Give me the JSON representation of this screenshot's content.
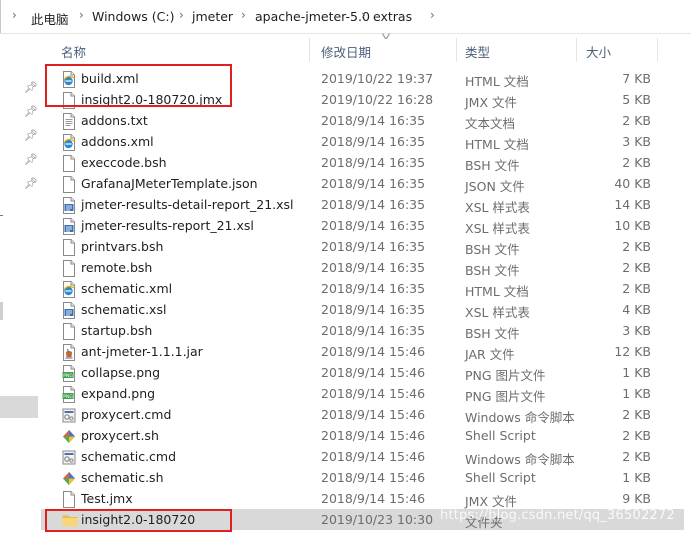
{
  "breadcrumb": [
    "此电脑",
    "Windows (C:)",
    "jmeter",
    "apache-jmeter-5.0",
    "extras"
  ],
  "columns": {
    "name": "名称",
    "date": "修改日期",
    "type": "类型",
    "size": "大小"
  },
  "files": [
    {
      "name": "build.xml",
      "date": "2019/10/22 19:37",
      "type": "HTML 文档",
      "size": "7 KB",
      "icon": "ie-html-icon"
    },
    {
      "name": "insight2.0-180720.jmx",
      "date": "2019/10/22 16:28",
      "type": "JMX 文件",
      "size": "5 KB",
      "icon": "blank-file-icon"
    },
    {
      "name": "addons.txt",
      "date": "2018/9/14 16:35",
      "type": "文本文档",
      "size": "2 KB",
      "icon": "text-file-icon"
    },
    {
      "name": "addons.xml",
      "date": "2018/9/14 16:35",
      "type": "HTML 文档",
      "size": "3 KB",
      "icon": "ie-html-icon"
    },
    {
      "name": "execcode.bsh",
      "date": "2018/9/14 16:35",
      "type": "BSH 文件",
      "size": "2 KB",
      "icon": "blank-file-icon"
    },
    {
      "name": "GrafanaJMeterTemplate.json",
      "date": "2018/9/14 16:35",
      "type": "JSON 文件",
      "size": "40 KB",
      "icon": "blank-file-icon"
    },
    {
      "name": "jmeter-results-detail-report_21.xsl",
      "date": "2018/9/14 16:35",
      "type": "XSL 样式表",
      "size": "14 KB",
      "icon": "xsl-file-icon"
    },
    {
      "name": "jmeter-results-report_21.xsl",
      "date": "2018/9/14 16:35",
      "type": "XSL 样式表",
      "size": "10 KB",
      "icon": "xsl-file-icon"
    },
    {
      "name": "printvars.bsh",
      "date": "2018/9/14 16:35",
      "type": "BSH 文件",
      "size": "2 KB",
      "icon": "blank-file-icon"
    },
    {
      "name": "remote.bsh",
      "date": "2018/9/14 16:35",
      "type": "BSH 文件",
      "size": "2 KB",
      "icon": "blank-file-icon"
    },
    {
      "name": "schematic.xml",
      "date": "2018/9/14 16:35",
      "type": "HTML 文档",
      "size": "2 KB",
      "icon": "ie-html-icon"
    },
    {
      "name": "schematic.xsl",
      "date": "2018/9/14 16:35",
      "type": "XSL 样式表",
      "size": "4 KB",
      "icon": "xsl-file-icon"
    },
    {
      "name": "startup.bsh",
      "date": "2018/9/14 16:35",
      "type": "BSH 文件",
      "size": "3 KB",
      "icon": "blank-file-icon"
    },
    {
      "name": "ant-jmeter-1.1.1.jar",
      "date": "2018/9/14 15:46",
      "type": "JAR 文件",
      "size": "12 KB",
      "icon": "jar-file-icon"
    },
    {
      "name": "collapse.png",
      "date": "2018/9/14 15:46",
      "type": "PNG 图片文件",
      "size": "1 KB",
      "icon": "png-file-icon"
    },
    {
      "name": "expand.png",
      "date": "2018/9/14 15:46",
      "type": "PNG 图片文件",
      "size": "1 KB",
      "icon": "png-file-icon"
    },
    {
      "name": "proxycert.cmd",
      "date": "2018/9/14 15:46",
      "type": "Windows 命令脚本",
      "size": "2 KB",
      "icon": "cmd-script-icon"
    },
    {
      "name": "proxycert.sh",
      "date": "2018/9/14 15:46",
      "type": "Shell Script",
      "size": "2 KB",
      "icon": "shell-script-icon"
    },
    {
      "name": "schematic.cmd",
      "date": "2018/9/14 15:46",
      "type": "Windows 命令脚本",
      "size": "2 KB",
      "icon": "cmd-script-icon"
    },
    {
      "name": "schematic.sh",
      "date": "2018/9/14 15:46",
      "type": "Shell Script",
      "size": "1 KB",
      "icon": "shell-script-icon"
    },
    {
      "name": "Test.jmx",
      "date": "2018/9/14 15:46",
      "type": "JMX 文件",
      "size": "9 KB",
      "icon": "blank-file-icon"
    },
    {
      "name": "insight2.0-180720",
      "date": "2019/10/23 10:30",
      "type": "文件夹",
      "size": "",
      "icon": "folder-icon",
      "selected": true
    }
  ],
  "watermark": "https://blog.csdn.net/qq_36502272",
  "colors": {
    "highlight": "#e02020",
    "selected_row": "#d9d9d9",
    "header_text": "#4c607a"
  }
}
